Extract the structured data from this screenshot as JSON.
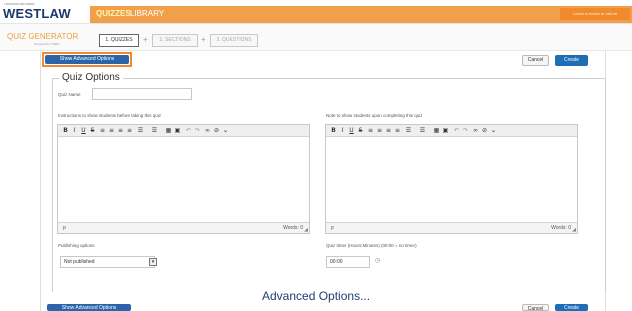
{
  "header": {
    "vendor_text": "THOMSON REUTERS",
    "logo": "WESTLAW",
    "nav": [
      "QUIZZES",
      "LIBRARY"
    ],
    "user_label": "Leave a review or call us"
  },
  "generator": {
    "title": "QUIZ GENERATOR",
    "subtitle": "Powered by TWEN",
    "steps": [
      "1. QUIZZES",
      "2. SECTIONS",
      "3. QUESTIONS"
    ],
    "step_separator": "+"
  },
  "actions": {
    "show_advanced": "Show Advanced Options",
    "cancel": "Cancel",
    "create": "Create"
  },
  "form": {
    "legend": "Quiz Options",
    "quiz_name_label": "Quiz Name",
    "quiz_name_value": "",
    "instructions_label": "Instructions to show students before taking this quiz",
    "note_label": "Note to show students upon completing this quiz",
    "editor_path": "p",
    "words_label": "Words: 0",
    "publishing_label": "Publishing options",
    "publishing_value": "Not published",
    "timer_label": "Quiz timer (Hours:Minutes) (00:00 = no timer)",
    "timer_value": "00:00"
  },
  "toolbar": {
    "bold": "B",
    "italic": "I",
    "underline": "U",
    "strike": "S",
    "align_left": "≡",
    "align_center": "≡",
    "align_right": "≡",
    "justify": "≡",
    "bullet_list": "☰",
    "numbered_list": "☰",
    "table": "▦",
    "image": "▣",
    "undo": "↶",
    "redo": "↷",
    "link": "∞",
    "unlink": "⊘",
    "more": "⌄"
  },
  "advanced_heading": "Advanced Options...",
  "colors": {
    "brand_navy": "#1b3a6b",
    "nav_orange": "#f0a04b",
    "highlight_orange": "#f08a2c",
    "primary_blue": "#1f6db4"
  }
}
